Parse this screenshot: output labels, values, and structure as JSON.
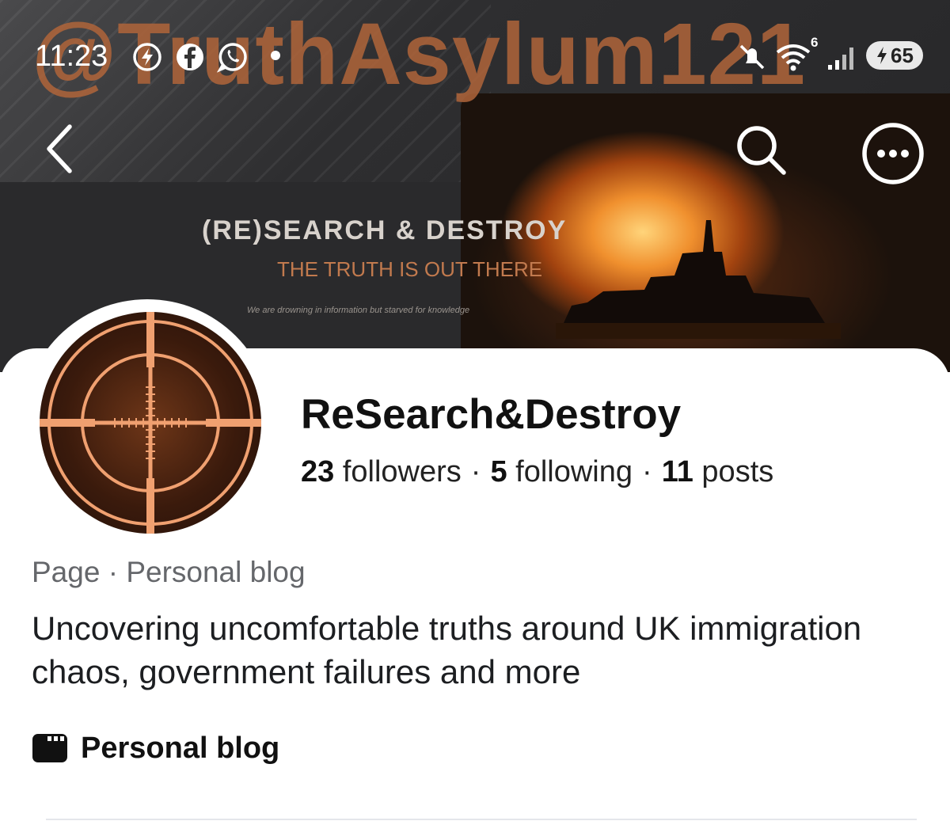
{
  "status_bar": {
    "time": "11:23",
    "battery_level": "65",
    "network_label": "6"
  },
  "cover": {
    "watermark": "@TruthAsylum121",
    "title": "(RE)SEARCH & DESTROY",
    "subtitle": "THE TRUTH IS OUT THERE",
    "tagline": "We are drowning in information but starved for knowledge"
  },
  "profile": {
    "name": "ReSearch&Destroy",
    "followers_count": "23",
    "followers_label": "followers",
    "following_count": "5",
    "following_label": "following",
    "posts_count": "11",
    "posts_label": "posts",
    "separator": "·",
    "category_type": "Page",
    "category_name": "Personal blog",
    "bio": "Uncovering uncomfortable truths around UK immigration chaos, government failures and more",
    "detail_label": "Personal blog"
  },
  "icons": {
    "back": "chevron-left-icon",
    "search": "search-icon",
    "more": "more-horizontal-icon",
    "detail": "blog-icon"
  },
  "colors": {
    "accent_orange": "#b0653a",
    "crosshair": "#f0a070"
  }
}
